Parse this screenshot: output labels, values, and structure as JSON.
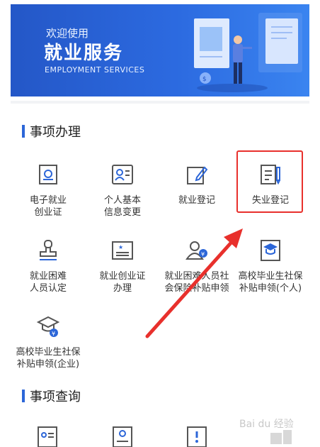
{
  "banner": {
    "welcome": "欢迎使用",
    "title": "就业服务",
    "subtitle": "EMPLOYMENT SERVICES"
  },
  "sections": {
    "handle": {
      "title": "事项办理",
      "items": [
        {
          "label": "电子就业\n创业证",
          "icon": "id-card-icon"
        },
        {
          "label": "个人基本\n信息变更",
          "icon": "user-card-icon"
        },
        {
          "label": "就业登记",
          "icon": "edit-icon"
        },
        {
          "label": "失业登记",
          "icon": "document-pen-icon"
        },
        {
          "label": "就业困难\n人员认定",
          "icon": "stamp-icon"
        },
        {
          "label": "就业创业证\n办理",
          "icon": "certificate-icon"
        },
        {
          "label": "就业困难人员社\n会保险补贴申领",
          "icon": "user-yen-icon"
        },
        {
          "label": "高校毕业生社保\n补贴申领(个人)",
          "icon": "graduation-book-icon"
        },
        {
          "label": "高校毕业生社保\n补贴申领(企业)",
          "icon": "graduation-yen-icon"
        }
      ]
    },
    "query": {
      "title": "事项查询"
    }
  },
  "watermark": {
    "text": "Bai du 经验"
  },
  "colors": {
    "accent": "#2c66d8",
    "highlight": "#e8302c",
    "icon": "#4a5568"
  }
}
